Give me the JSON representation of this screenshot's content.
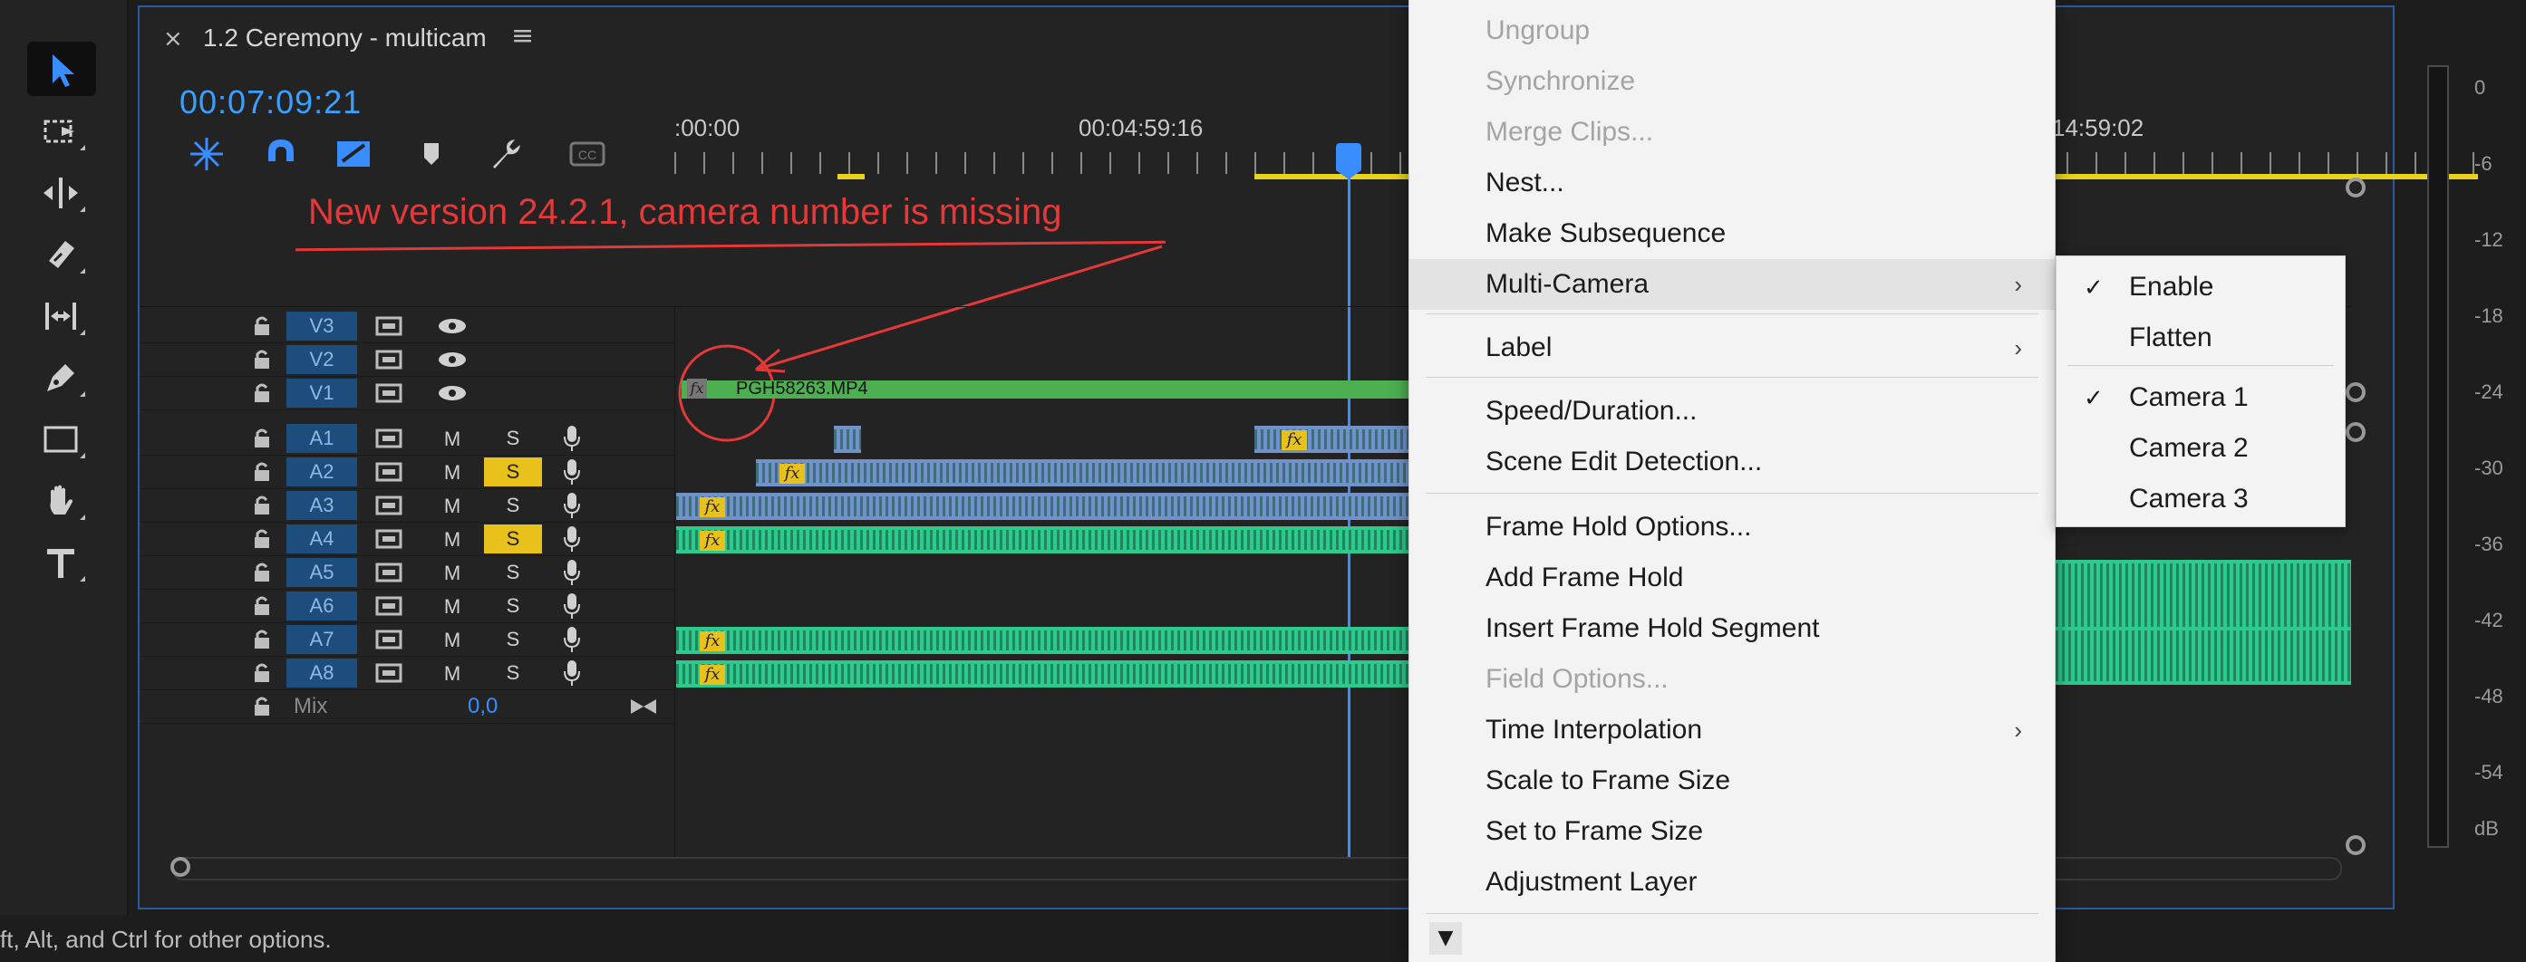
{
  "tab": {
    "close": "×",
    "title": "1.2 Ceremony - multicam",
    "menu": "≡"
  },
  "timecode": "00:07:09:21",
  "ruler": {
    "labels": [
      ":00:00",
      "00:04:59:16",
      "14:59:02"
    ]
  },
  "annotation": "New version 24.2.1, camera number is missing",
  "video_tracks": [
    {
      "name": "V3"
    },
    {
      "name": "V2"
    },
    {
      "name": "V1"
    }
  ],
  "audio_tracks": [
    {
      "name": "A1",
      "m": "M",
      "s": "S",
      "solo": false
    },
    {
      "name": "A2",
      "m": "M",
      "s": "S",
      "solo": true
    },
    {
      "name": "A3",
      "m": "M",
      "s": "S",
      "solo": false
    },
    {
      "name": "A4",
      "m": "M",
      "s": "S",
      "solo": true
    },
    {
      "name": "A5",
      "m": "M",
      "s": "S",
      "solo": false
    },
    {
      "name": "A6",
      "m": "M",
      "s": "S",
      "solo": false
    },
    {
      "name": "A7",
      "m": "M",
      "s": "S",
      "solo": false
    },
    {
      "name": "A8",
      "m": "M",
      "s": "S",
      "solo": false
    }
  ],
  "mix": {
    "label": "Mix",
    "value": "0,0"
  },
  "clip": {
    "name": "PGH58263.MP4",
    "fx": "fx"
  },
  "context_menu": {
    "items": [
      {
        "label": "Ungroup",
        "disabled": true
      },
      {
        "label": "Synchronize",
        "disabled": true
      },
      {
        "label": "Merge Clips...",
        "disabled": true
      },
      {
        "label": "Nest...",
        "disabled": false
      },
      {
        "label": "Make Subsequence",
        "disabled": false
      },
      {
        "label": "Multi-Camera",
        "disabled": false,
        "submenu": true
      },
      {
        "label": "Label",
        "disabled": false,
        "submenu": true
      },
      {
        "label": "Speed/Duration...",
        "disabled": false
      },
      {
        "label": "Scene Edit Detection...",
        "disabled": false
      },
      {
        "label": "Frame Hold Options...",
        "disabled": false
      },
      {
        "label": "Add Frame Hold",
        "disabled": false
      },
      {
        "label": "Insert Frame Hold Segment",
        "disabled": false
      },
      {
        "label": "Field Options...",
        "disabled": true
      },
      {
        "label": "Time Interpolation",
        "disabled": false,
        "submenu": true
      },
      {
        "label": "Scale to Frame Size",
        "disabled": false
      },
      {
        "label": "Set to Frame Size",
        "disabled": false
      },
      {
        "label": "Adjustment Layer",
        "disabled": false
      }
    ],
    "submenu_arrow": "›",
    "more_arrow": "▼"
  },
  "multicam_submenu": {
    "check": "✓",
    "items": [
      {
        "label": "Enable",
        "checked": true
      },
      {
        "label": "Flatten",
        "checked": false
      },
      {
        "label": "Camera 1",
        "checked": true
      },
      {
        "label": "Camera 2",
        "checked": false
      },
      {
        "label": "Camera 3",
        "checked": false
      }
    ]
  },
  "meter": {
    "labels": [
      "0",
      "-6",
      "-12",
      "-18",
      "-24",
      "-30",
      "-36",
      "-42",
      "-48",
      "-54",
      "dB"
    ]
  },
  "status": "ft, Alt, and Ctrl for other options.",
  "colors": {
    "accent": "#3a8dff",
    "solo": "#e8c21a",
    "annotation": "#e53838"
  }
}
